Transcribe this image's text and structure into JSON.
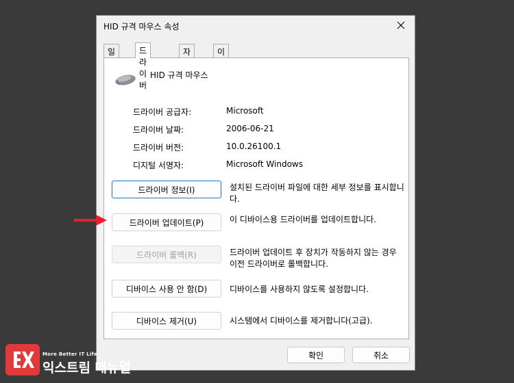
{
  "window": {
    "title": "HID 규격 마우스 속성"
  },
  "tabs": [
    {
      "label": "일반"
    },
    {
      "label": "드라이버"
    },
    {
      "label": "자세히"
    },
    {
      "label": "이벤트"
    }
  ],
  "device": {
    "name": "HID 규격 마우스",
    "icon": "mouse-icon"
  },
  "properties": [
    {
      "label": "드라이버 공급자:",
      "value": "Microsoft"
    },
    {
      "label": "드라이버 날짜:",
      "value": "2006-06-21"
    },
    {
      "label": "드라이버 버전:",
      "value": "10.0.26100.1"
    },
    {
      "label": "디지털 서명자:",
      "value": "Microsoft Windows"
    }
  ],
  "actions": [
    {
      "button": "드라이버 정보(I)",
      "description": "설치된 드라이버 파일에 대한 세부 정보를 표시합니다."
    },
    {
      "button": "드라이버 업데이트(P)",
      "description": "이 디바이스용 드라이버를 업데이트합니다."
    },
    {
      "button": "드라이버 롤백(R)",
      "description": "드라이버 업데이트 후 장치가 작동하지 않는 경우 이전 드라이버로 롤백합니다."
    },
    {
      "button": "디바이스 사용 안 함(D)",
      "description": "디바이스를 사용하지 않도록 설정합니다."
    },
    {
      "button": "디바이스 제거(U)",
      "description": "시스템에서 디바이스를 제거합니다(고급)."
    }
  ],
  "footer": {
    "ok": "확인",
    "cancel": "취소"
  },
  "watermark": {
    "tagline": "More Better IT Life",
    "name": "익스트림 매뉴얼"
  },
  "colors": {
    "accent": "#1a73c8",
    "arrow": "#e8202a",
    "logo": "#e03a3a"
  }
}
